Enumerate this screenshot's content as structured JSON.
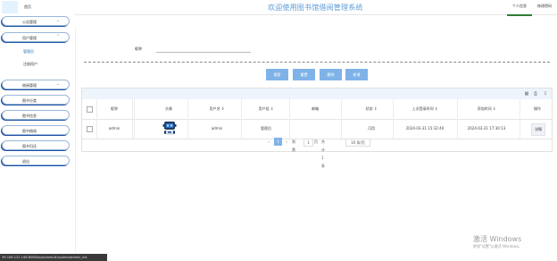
{
  "header": {
    "home": "首页",
    "title": "欢迎使用图书馆借阅管理系统",
    "tabs": [
      "个人信息",
      "修改密码"
    ]
  },
  "sidebar": {
    "menus": [
      {
        "label": "公告管理",
        "chev": "⌄"
      },
      {
        "label": "用户管理",
        "chev": "⌃"
      },
      {
        "label": "借阅管理",
        "chev": "⌄"
      },
      {
        "label": "图书分类",
        "chev": ""
      },
      {
        "label": "图书信息",
        "chev": ""
      },
      {
        "label": "图书借阅",
        "chev": ""
      },
      {
        "label": "图书归还",
        "chev": ""
      },
      {
        "label": "退出",
        "chev": ""
      }
    ],
    "submenus": [
      "管理员",
      "注册用户"
    ]
  },
  "search": {
    "label": "昵称",
    "value": ""
  },
  "buttons": [
    "搜索",
    "重置",
    "删除",
    "新增"
  ],
  "table": {
    "headers": [
      "昵称",
      "头像",
      "用户名",
      "用户组",
      "邮箱",
      "状态",
      "上次登录时间",
      "添加时间",
      "操作"
    ],
    "sort_glyph": "⇕",
    "rows": [
      {
        "nickname": "admin",
        "avatar": "robot-avatar",
        "username": "admin",
        "group": "管理员",
        "email": "",
        "status": "可用",
        "last_login": "2024-03-31 15:32:40",
        "added": "2024-03-31 17:30:13",
        "action": "详情"
      }
    ]
  },
  "pagination": {
    "prev": "‹",
    "current": "1",
    "next": "›",
    "goto_label": "到第",
    "goto_value": "1",
    "page_unit": "页",
    "total": "共计1条",
    "page_size": "10 条/页"
  },
  "watermark": {
    "line1": "激活 Windows",
    "line2": "转到\"设置\"以激活 Windows。"
  },
  "statusbar": "39.108.122.148:8080/login/web/#/system/admin_list"
}
